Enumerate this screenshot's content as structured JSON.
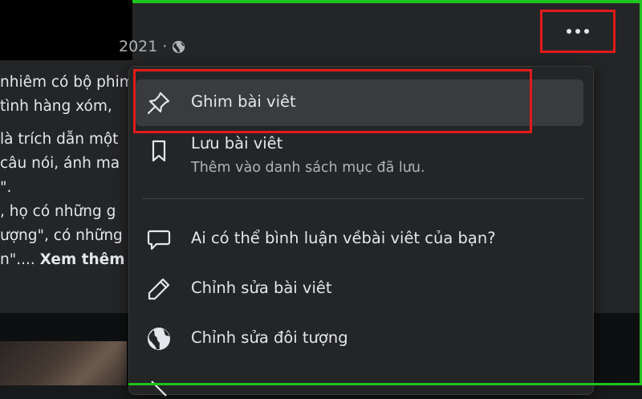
{
  "post": {
    "meta_date": "2021 ·",
    "text_lines": [
      "nhiêm có bộ phim",
      "tình hàng xóm,",
      "là trích dẫn một",
      "câu nói, ánh ma",
      "\".",
      ", họ có những g",
      "ượng\", có những",
      "n\".... "
    ],
    "see_more": "Xem thêm"
  },
  "more_button": {
    "icon": "more-horizontal-icon"
  },
  "menu": {
    "pin": {
      "label": "Ghim bài viêt",
      "icon": "pin-icon"
    },
    "save": {
      "label": "Lưu bài viêt",
      "sublabel": "Thêm vào danh sách mục đã lưu.",
      "icon": "bookmark-icon"
    },
    "comment": {
      "label": "Ai có thể bình luận vềbài viêt của bạn?",
      "icon": "speech-bubble-icon"
    },
    "edit": {
      "label": "Chỉnh sửa bài viêt",
      "icon": "pencil-icon"
    },
    "audience": {
      "label": "Chỉnh sửa đôi tượng",
      "icon": "globe-icon"
    }
  },
  "colors": {
    "highlight": "#e01b1b",
    "frame": "#1ec41e",
    "menu_bg": "#242526",
    "menu_hover": "#3a3b3c"
  }
}
